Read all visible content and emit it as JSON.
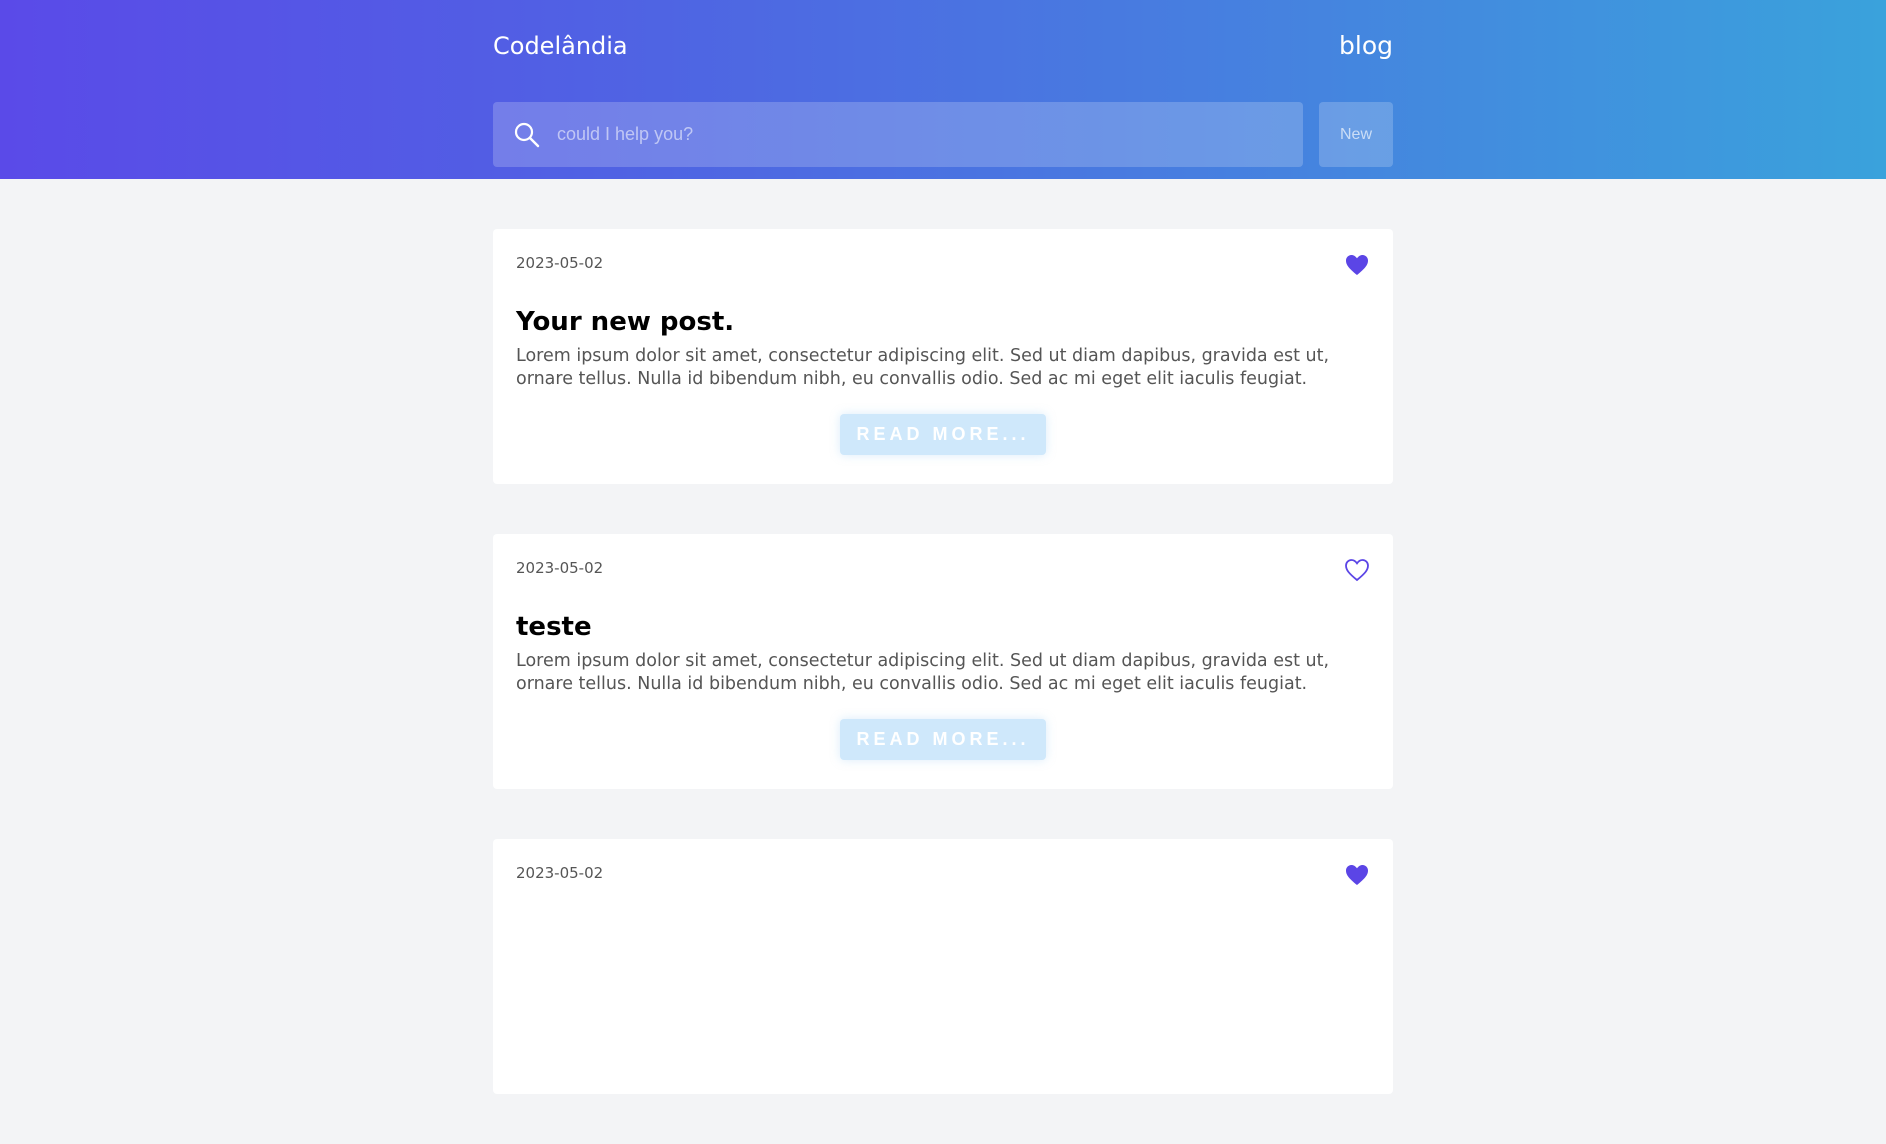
{
  "header": {
    "brand": "Codelândia",
    "nav_link": "blog",
    "search_placeholder": "could I help you?",
    "search_value": "",
    "new_button": "New"
  },
  "posts": [
    {
      "date": "2023-05-02",
      "title": "Your new post.",
      "body": "Lorem ipsum dolor sit amet, consectetur adipiscing elit. Sed ut diam dapibus, gravida est ut, ornare tellus. Nulla id bibendum nibh, eu convallis odio. Sed ac mi eget elit iaculis feugiat.",
      "read_more": "READ MORE...",
      "liked": true
    },
    {
      "date": "2023-05-02",
      "title": "teste",
      "body": "Lorem ipsum dolor sit amet, consectetur adipiscing elit. Sed ut diam dapibus, gravida est ut, ornare tellus. Nulla id bibendum nibh, eu convallis odio. Sed ac mi eget elit iaculis feugiat.",
      "read_more": "READ MORE...",
      "liked": false
    },
    {
      "date": "2023-05-02",
      "title": "",
      "body": "",
      "read_more": "",
      "liked": true
    }
  ],
  "colors": {
    "accent": "#5b45e6",
    "button_bg": "#cfe8fb"
  },
  "icons": {
    "search": "search-icon",
    "heart_filled": "heart-filled-icon",
    "heart_outline": "heart-outline-icon"
  }
}
